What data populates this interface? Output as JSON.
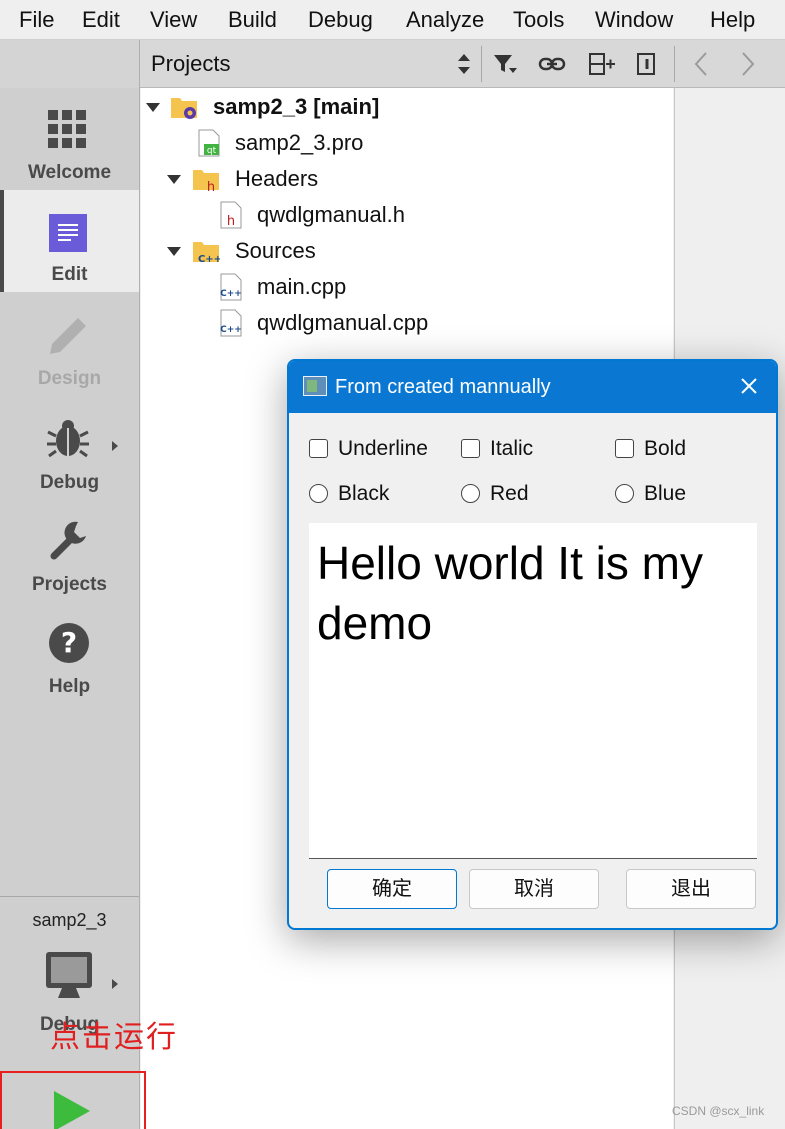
{
  "menubar": {
    "items": [
      "File",
      "Edit",
      "View",
      "Build",
      "Debug",
      "Analyze",
      "Tools",
      "Window",
      "Help"
    ]
  },
  "toolbar": {
    "panel_title": "Projects"
  },
  "modes": [
    {
      "label": "Welcome",
      "icon": "grid-icon",
      "state": "normal"
    },
    {
      "label": "Edit",
      "icon": "document-icon",
      "state": "active"
    },
    {
      "label": "Design",
      "icon": "pencil-icon",
      "state": "disabled"
    },
    {
      "label": "Debug",
      "icon": "bug-icon",
      "state": "normal"
    },
    {
      "label": "Projects",
      "icon": "wrench-icon",
      "state": "normal"
    },
    {
      "label": "Help",
      "icon": "question-icon",
      "state": "normal"
    }
  ],
  "kit": {
    "project_name": "samp2_3",
    "build_config": "Debug"
  },
  "tree": [
    {
      "label": "samp2_3 [main]",
      "icon": "project-folder-icon",
      "bold": true,
      "expanded": true
    },
    {
      "label": "samp2_3.pro",
      "icon": "qt-pro-file-icon"
    },
    {
      "label": "Headers",
      "icon": "headers-folder-icon",
      "expanded": true
    },
    {
      "label": "qwdlgmanual.h",
      "icon": "header-file-icon"
    },
    {
      "label": "Sources",
      "icon": "sources-folder-icon",
      "expanded": true
    },
    {
      "label": "main.cpp",
      "icon": "cpp-file-icon"
    },
    {
      "label": "qwdlgmanual.cpp",
      "icon": "cpp-file-icon"
    }
  ],
  "dialog": {
    "title": "From created mannually",
    "checkboxes": [
      {
        "label": "Underline",
        "checked": false
      },
      {
        "label": "Italic",
        "checked": false
      },
      {
        "label": "Bold",
        "checked": false
      }
    ],
    "radios": [
      {
        "label": "Black",
        "checked": false
      },
      {
        "label": "Red",
        "checked": false
      },
      {
        "label": "Blue",
        "checked": false
      }
    ],
    "text": "Hello world It is my demo",
    "buttons": {
      "ok": "确定",
      "cancel": "取消",
      "exit": "退出"
    }
  },
  "annotation": {
    "run_hint": "点击运行",
    "color": "#e02020"
  },
  "watermark": "CSDN @scx_link",
  "colors": {
    "accent": "#0078d4",
    "run_green": "#3dbb3d"
  }
}
